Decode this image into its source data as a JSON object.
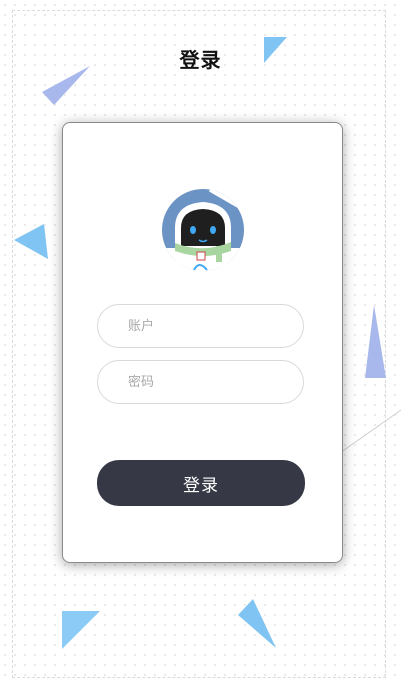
{
  "header": {
    "title": "登录"
  },
  "login_form": {
    "account_placeholder": "账户",
    "password_placeholder": "密码",
    "submit_label": "登录"
  },
  "colors": {
    "button_bg": "#363945",
    "triangle_blue": "#7fc4f2",
    "triangle_lavender": "#a9b8ec",
    "avatar_bg": "#6b93c4"
  }
}
